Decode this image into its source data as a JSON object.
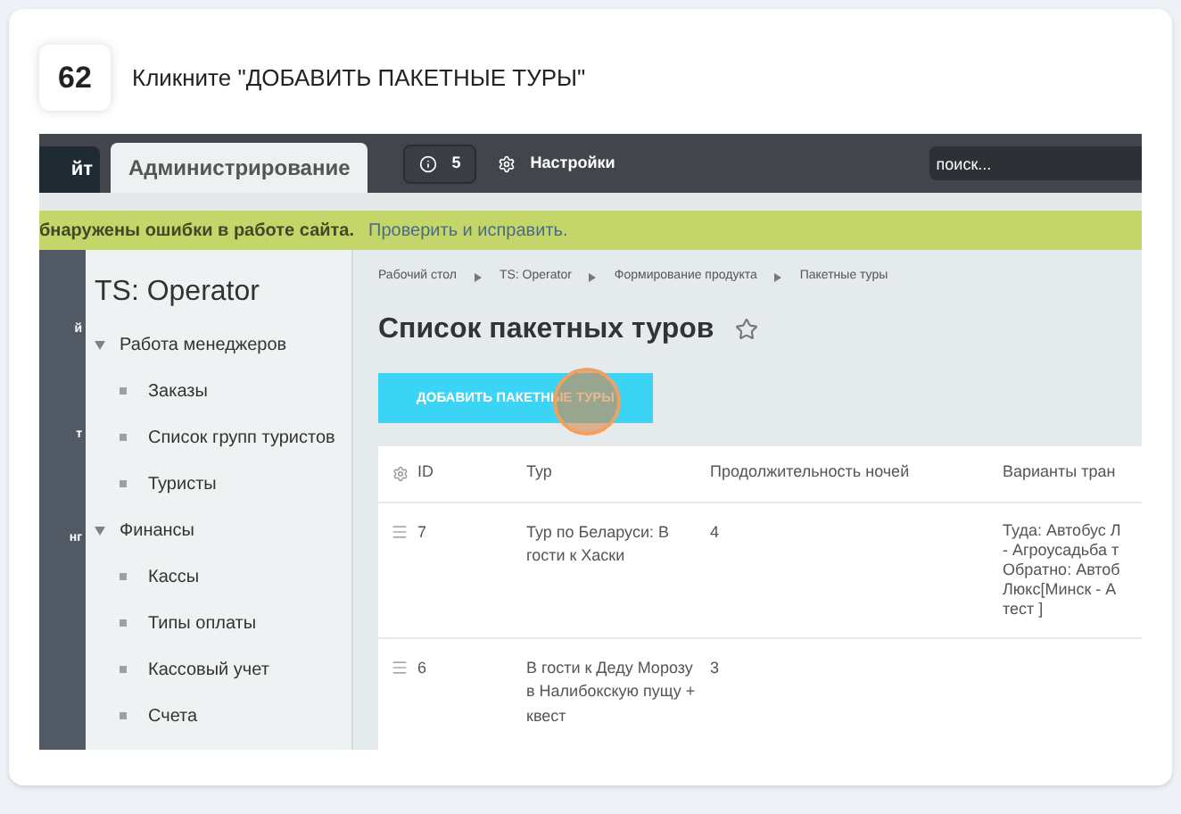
{
  "step": {
    "number": "62",
    "instruction": "Кликните \"ДОБАВИТЬ ПАКЕТНЫЕ ТУРЫ\""
  },
  "topbar": {
    "site_tab": "йт",
    "admin_tab": "Администрирование",
    "notifications": "5",
    "settings": "Настройки",
    "search": {
      "placeholder": "поиск..."
    }
  },
  "alert": {
    "message": "бнаружены ошибки в работе сайта.",
    "link": "Проверить и исправить."
  },
  "left_rail": [
    "й",
    "т",
    "нг"
  ],
  "sidebar": {
    "title": "TS: Operator",
    "items": [
      {
        "label": "Работа менеджеров",
        "expanded": true,
        "children": [
          {
            "label": "Заказы"
          },
          {
            "label": "Список групп туристов"
          },
          {
            "label": "Туристы"
          }
        ]
      },
      {
        "label": "Финансы",
        "expanded": true,
        "children": [
          {
            "label": "Кассы"
          },
          {
            "label": "Типы оплаты"
          },
          {
            "label": "Кассовый учет"
          },
          {
            "label": "Счета"
          }
        ]
      }
    ]
  },
  "breadcrumbs": [
    "Рабочий стол",
    "TS: Operator",
    "Формирование продукта",
    "Пакетные туры"
  ],
  "page_title": "Список пакетных туров",
  "add_button": "ДОБАВИТЬ ПАКЕТНЫЕ ТУРЫ",
  "table": {
    "columns": [
      "ID",
      "Тур",
      "Продолжительность ночей",
      "Варианты тран"
    ],
    "rows": [
      {
        "id": "7",
        "tour": "Тур по Беларуси: В гости к Хаски",
        "nights": "4",
        "transport": [
          "Туда: Автобус Л",
          "- Агроусадьба т",
          "Обратно: Автоб",
          "Люкс[Минск - А",
          "тест ]"
        ]
      },
      {
        "id": "6",
        "tour": "В гости к Деду Морозу в Налибокскую пущу + квест",
        "nights": "3",
        "transport": []
      }
    ]
  }
}
